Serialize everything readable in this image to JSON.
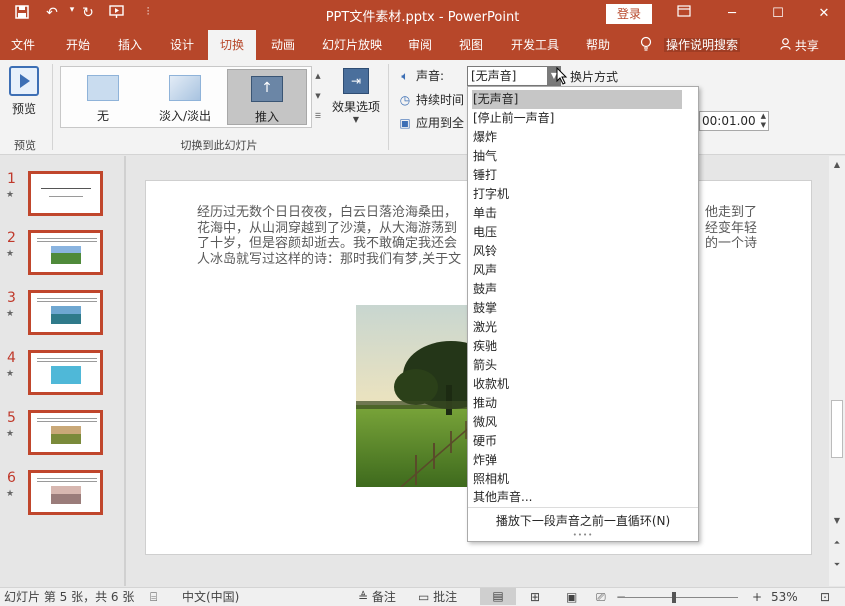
{
  "title_bar": {
    "title": "PPT文件素材.pptx  -  PowerPoint",
    "login_label": "登录",
    "quick_access": [
      "save-icon",
      "undo-icon",
      "redo-icon",
      "slideshow-from-start-icon",
      "customize-icon"
    ]
  },
  "tabs": {
    "items": [
      "文件",
      "开始",
      "插入",
      "设计",
      "切换",
      "动画",
      "幻灯片放映",
      "审阅",
      "视图",
      "开发工具",
      "帮助"
    ],
    "active": "切换",
    "tell_me": "操作说明搜索",
    "share": "共享"
  },
  "ribbon": {
    "preview_label": "预览",
    "preview_group": "预览",
    "transition_group": "切换到此幻灯片",
    "transitions": [
      "无",
      "淡入/淡出",
      "推入"
    ],
    "selected_transition": "推入",
    "effect_options": "效果选项",
    "sound_label": "声音:",
    "sound_value": "[无声音]",
    "switch_mode": "换片方式",
    "duration_label": "持续时间",
    "apply_all_label": "应用到全",
    "time_value": "00:01.00"
  },
  "sound_options": [
    "[无声音]",
    "[停止前一声音]",
    "爆炸",
    "抽气",
    "锤打",
    "打字机",
    "单击",
    "电压",
    "风铃",
    "风声",
    "鼓声",
    "鼓掌",
    "激光",
    "疾驰",
    "箭头",
    "收款机",
    "推动",
    "微风",
    "硬币",
    "炸弹",
    "照相机",
    "其他声音..."
  ],
  "loop_label": "播放下一段声音之前一直循环(N)",
  "slides": {
    "numbers": [
      "1",
      "2",
      "3",
      "4",
      "5",
      "6"
    ]
  },
  "slide_content": {
    "line1": "经历过无数个日日夜夜，白云日落沧海桑田，",
    "line1b": "他走到了",
    "line2": "花海中，从山洞穿越到了沙漠，从大海游荡到",
    "line2b": "经变年轻",
    "line3": "了十岁，但是容颜却逝去。我不敢确定我还会",
    "line3b": "的一个诗",
    "line4": "人冰岛就写过这样的诗：那时我们有梦,关于文"
  },
  "status_bar": {
    "slide_info": "幻灯片 第 5 张，共 6 张",
    "language": "中文(中国)",
    "notes": "备注",
    "comments": "批注",
    "zoom": "53%"
  },
  "colors": {
    "accent": "#b7472a",
    "thumb_border": "#c0462c"
  }
}
